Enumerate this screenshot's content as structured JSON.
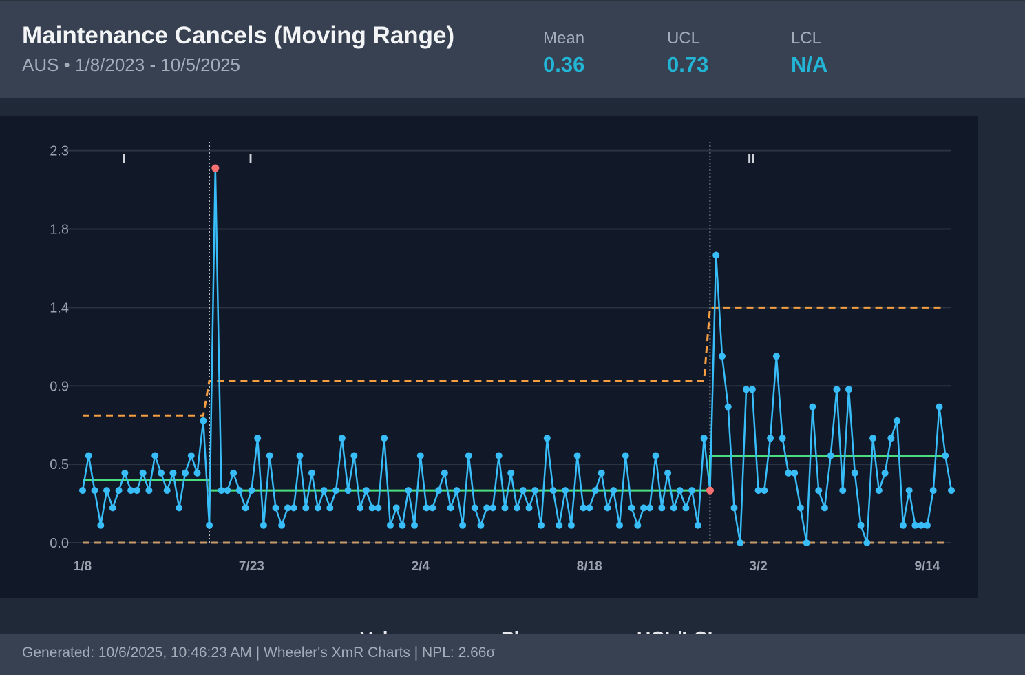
{
  "header": {
    "title": "Maintenance Cancels (Moving Range)",
    "subtitle": "AUS • 1/8/2023 - 10/5/2025",
    "stats": [
      {
        "label": "Mean",
        "value": "0.36"
      },
      {
        "label": "UCL",
        "value": "0.73"
      },
      {
        "label": "LCL",
        "value": "N/A"
      }
    ]
  },
  "colors": {
    "accent": "#22b5d6",
    "series": "#38bdf8",
    "mean_line": "#4ade80",
    "limit_line": "#f59e42",
    "violation_point": "#f87171"
  },
  "chart_data": {
    "type": "line",
    "title": "",
    "xlabel": "",
    "ylabel": "",
    "ylim": [
      0,
      2.3
    ],
    "yticks": [
      "0.0",
      "0.5",
      "0.9",
      "1.4",
      "1.8",
      "2.3"
    ],
    "ytick_values": [
      0,
      0.45,
      0.9,
      1.35,
      1.8,
      2.25
    ],
    "xtick_labels": [
      "1/8",
      "7/23",
      "2/4",
      "8/18",
      "3/2",
      "9/14"
    ],
    "xtick_indices": [
      0,
      28,
      56,
      84,
      112,
      140
    ],
    "grid": true,
    "phases": [
      {
        "label": "I",
        "start": 0,
        "end": 21
      },
      {
        "label": "I",
        "start": 21,
        "end": 104
      },
      {
        "label": "II",
        "start": 104,
        "end": 143
      }
    ],
    "series": [
      {
        "values": [
          0.3,
          0.5,
          0.3,
          0.1,
          0.3,
          0.2,
          0.3,
          0.4,
          0.3,
          0.3,
          0.4,
          0.3,
          0.5,
          0.4,
          0.3,
          0.4,
          0.2,
          0.4,
          0.5,
          0.4,
          0.7,
          0.1,
          2.15,
          0.3,
          0.3,
          0.4,
          0.3,
          0.2,
          0.3,
          0.6,
          0.1,
          0.5,
          0.2,
          0.1,
          0.2,
          0.2,
          0.5,
          0.2,
          0.4,
          0.2,
          0.3,
          0.2,
          0.3,
          0.6,
          0.3,
          0.5,
          0.2,
          0.3,
          0.2,
          0.2,
          0.6,
          0.1,
          0.2,
          0.1,
          0.3,
          0.1,
          0.5,
          0.2,
          0.2,
          0.3,
          0.4,
          0.2,
          0.3,
          0.1,
          0.5,
          0.2,
          0.1,
          0.2,
          0.2,
          0.5,
          0.2,
          0.4,
          0.2,
          0.3,
          0.2,
          0.3,
          0.1,
          0.6,
          0.3,
          0.1,
          0.3,
          0.1,
          0.5,
          0.2,
          0.2,
          0.3,
          0.4,
          0.2,
          0.3,
          0.1,
          0.5,
          0.2,
          0.1,
          0.2,
          0.2,
          0.5,
          0.2,
          0.4,
          0.2,
          0.3,
          0.2,
          0.3,
          0.1,
          0.6,
          0.3,
          1.65,
          1.07,
          0.78,
          0.2,
          0.0,
          0.88,
          0.88,
          0.3,
          0.3,
          0.6,
          1.07,
          0.6,
          0.4,
          0.4,
          0.2,
          0.0,
          0.78,
          0.3,
          0.2,
          0.5,
          0.88,
          0.3,
          0.88,
          0.4,
          0.1,
          0.0,
          0.6,
          0.3,
          0.4,
          0.6,
          0.7,
          0.1,
          0.3,
          0.1,
          0.1,
          0.1,
          0.3,
          0.78,
          0.5,
          0.3
        ]
      }
    ],
    "mean_segments": [
      {
        "start": 0,
        "end": 21,
        "value": 0.36
      },
      {
        "start": 21,
        "end": 104,
        "value": 0.3
      },
      {
        "start": 104,
        "end": 143,
        "value": 0.5
      }
    ],
    "ucl_segments": [
      {
        "start": 0,
        "end": 20,
        "value": 0.73
      },
      {
        "start": 21,
        "end": 103,
        "value": 0.93
      },
      {
        "start": 104,
        "end": 143,
        "value": 1.35
      }
    ],
    "lcl_value": 0.0,
    "violations": [
      22,
      104
    ]
  },
  "legend_peek": [
    "Values",
    "Phases",
    "UCL/LCL"
  ],
  "footer": {
    "text": "Generated: 10/6/2025, 10:46:23 AM | Wheeler's XmR Charts | NPL: 2.66σ"
  }
}
